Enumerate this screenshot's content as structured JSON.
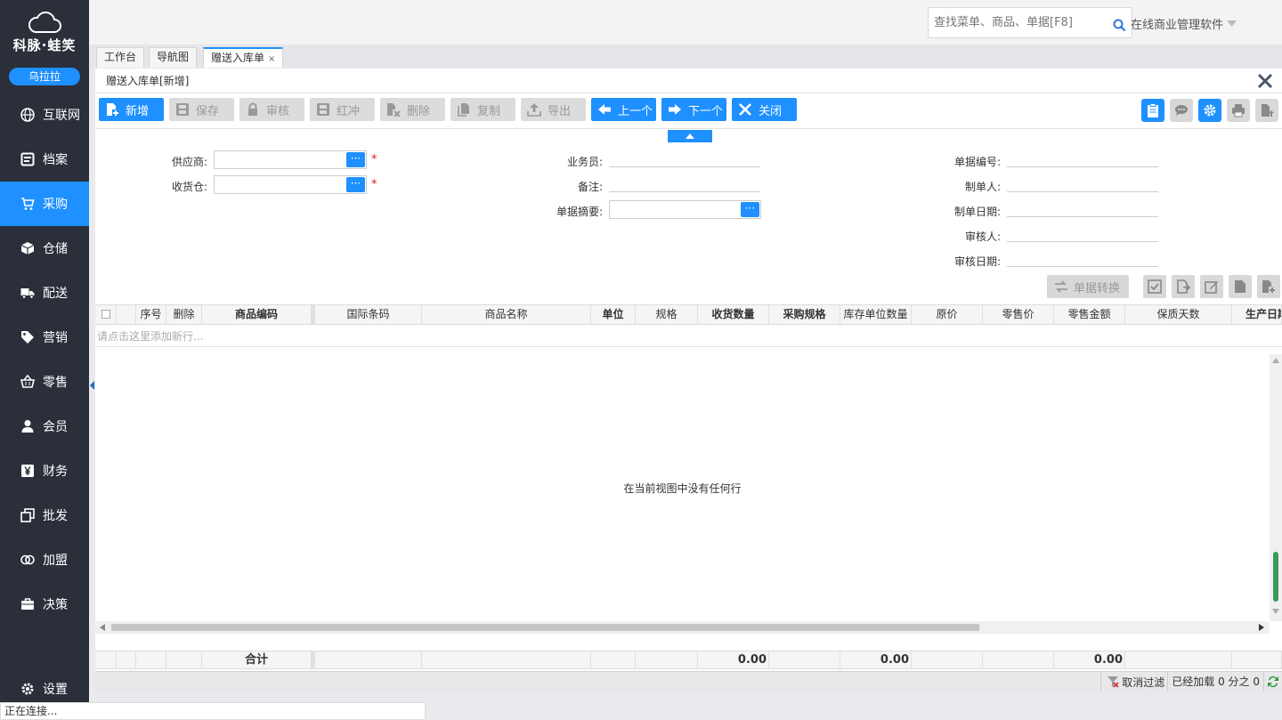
{
  "brand": {
    "logo_text": "科脉·蛙笑",
    "user": "乌拉拉"
  },
  "nav": [
    {
      "label": "互联网",
      "icon": "globe-icon",
      "active": false
    },
    {
      "label": "档案",
      "icon": "archive-icon",
      "active": false
    },
    {
      "label": "采购",
      "icon": "cart-icon",
      "active": true
    },
    {
      "label": "仓储",
      "icon": "box-icon",
      "active": false
    },
    {
      "label": "配送",
      "icon": "truck-icon",
      "active": false
    },
    {
      "label": "营销",
      "icon": "tag-icon",
      "active": false
    },
    {
      "label": "零售",
      "icon": "basket-icon",
      "active": false
    },
    {
      "label": "会员",
      "icon": "user-icon",
      "active": false
    },
    {
      "label": "财务",
      "icon": "yen-icon",
      "active": false
    },
    {
      "label": "批发",
      "icon": "copy-icon",
      "active": false
    },
    {
      "label": "加盟",
      "icon": "rings-icon",
      "active": false
    },
    {
      "label": "决策",
      "icon": "briefcase-icon",
      "active": false
    },
    {
      "label": "设置",
      "icon": "gear-icon",
      "active": false
    }
  ],
  "top": {
    "search_placeholder": "查找菜单、商品、单据[F8]",
    "product_name": "在线商业管理软件"
  },
  "tabs": [
    {
      "label": "工作台",
      "active": false
    },
    {
      "label": "导航图",
      "active": false
    },
    {
      "label": "赠送入库单",
      "active": true,
      "close": "×"
    }
  ],
  "panel": {
    "title": "赠送入库单[新增]"
  },
  "toolbar": {
    "new": "新增",
    "save": "保存",
    "audit": "审核",
    "redflush": "红冲",
    "delete": "删除",
    "copy": "复制",
    "export": "导出",
    "prev": "上一个",
    "next": "下一个",
    "close": "关闭"
  },
  "form": {
    "supplier_label": "供应商:",
    "warehouse_label": "收货仓:",
    "salesman_label": "业务员:",
    "remark_label": "备注:",
    "summary_label": "单据摘要:",
    "docno_label": "单据编号:",
    "maker_label": "制单人:",
    "makedate_label": "制单日期:",
    "auditor_label": "审核人:",
    "auditdate_label": "审核日期:",
    "dots": "···",
    "required": "*"
  },
  "convert_label": "单据转换",
  "grid": {
    "columns": [
      "序号",
      "删除",
      "商品编码",
      "国际条码",
      "商品名称",
      "单位",
      "规格",
      "收货数量",
      "采购规格",
      "库存单位数量",
      "原价",
      "零售价",
      "零售金额",
      "保质天数",
      "生产日期"
    ],
    "add_row_hint": "请点击这里添加新行...",
    "empty_text": "在当前视图中没有任何行"
  },
  "footer": {
    "total_label": "合计",
    "qty_total": "0.00",
    "stock_qty_total": "0.00",
    "retail_amount_total": "0.00"
  },
  "status": {
    "cancel_filter": "取消过滤",
    "loaded": "已经加载 0 分之 0"
  },
  "connection": "正在连接..."
}
